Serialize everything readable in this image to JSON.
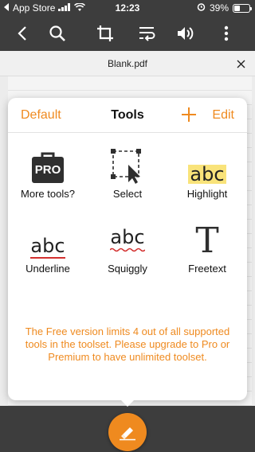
{
  "status_bar": {
    "carrier": "App Store",
    "time": "12:23",
    "battery": "39%",
    "battery_level": 0.39
  },
  "toolbar": {
    "icons": [
      "back-icon",
      "search-icon",
      "crop-icon",
      "reflow-icon",
      "speaker-icon",
      "more-icon"
    ]
  },
  "document": {
    "title": "Blank.pdf"
  },
  "tools_panel": {
    "default_label": "Default",
    "title": "Tools",
    "edit_label": "Edit",
    "tools": [
      {
        "label": "More tools?",
        "icon": "pro-briefcase-icon",
        "badge": "PRO"
      },
      {
        "label": "Select",
        "icon": "select-icon"
      },
      {
        "label": "Highlight",
        "icon": "highlight-icon",
        "sample": "abc"
      },
      {
        "label": "Underline",
        "icon": "underline-icon",
        "sample": "abc"
      },
      {
        "label": "Squiggly",
        "icon": "squiggly-icon",
        "sample": "abc"
      },
      {
        "label": "Freetext",
        "icon": "freetext-icon",
        "sample": "T"
      }
    ],
    "notice": "The Free version limits 4 out of all supported tools in the toolset. Please upgrade to Pro or Premium to have unlimited toolset."
  },
  "colors": {
    "accent": "#ef8a1f",
    "bar": "#3d3d3d",
    "highlight": "#f9e37a",
    "underline": "#d3302f"
  }
}
